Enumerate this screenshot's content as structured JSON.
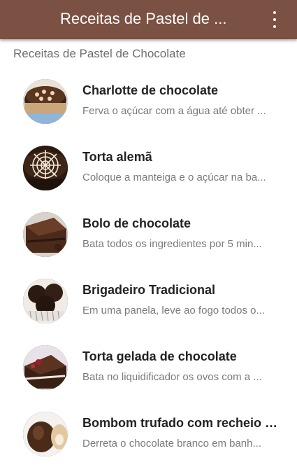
{
  "app_bar": {
    "title": "Receitas de Pastel de ...",
    "menu_icon": "more-vert-icon"
  },
  "section_header": "Receitas de Pastel de Chocolate",
  "recipes": [
    {
      "title": "Charlotte de chocolate",
      "subtitle": "Ferva o açúcar com a água até obter ..."
    },
    {
      "title": "Torta alemã",
      "subtitle": "Coloque a manteiga e o açúcar na ba..."
    },
    {
      "title": "Bolo de chocolate",
      "subtitle": "Bata todos os ingredientes por 5 min..."
    },
    {
      "title": "Brigadeiro Tradicional",
      "subtitle": "Em uma panela, leve ao fogo todos o..."
    },
    {
      "title": "Torta gelada de chocolate",
      "subtitle": "Bata no liquidificador os ovos com a ..."
    },
    {
      "title": "Bombom trufado com recheio d...",
      "subtitle": "Derreta o chocolate branco em banh..."
    }
  ],
  "colors": {
    "app_bar": "#7b5143",
    "title_text": "#222222",
    "subtitle_text": "#7a7a7a"
  }
}
